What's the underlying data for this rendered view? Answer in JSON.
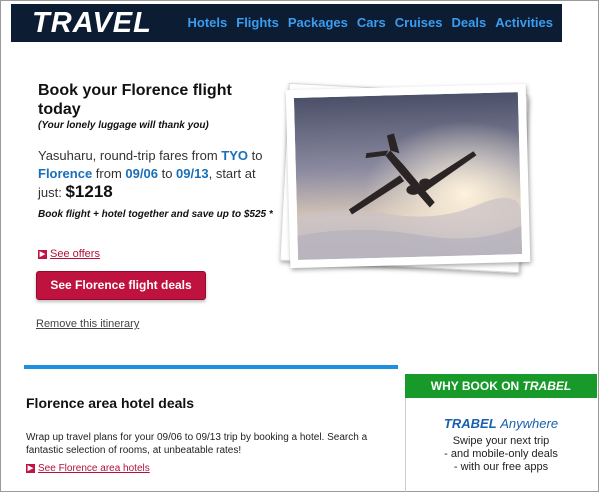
{
  "header": {
    "logo": "TRAVEL",
    "nav": [
      "Hotels",
      "Flights",
      "Packages",
      "Cars",
      "Cruises",
      "Deals",
      "Activities"
    ]
  },
  "hero": {
    "title": "Book your Florence flight today",
    "subtitle": "(Your lonely luggage will thank you)",
    "fares": {
      "prefix": "Yasuharu, round-trip fares from ",
      "origin": "TYO",
      "to1": " to ",
      "destination": "Florence",
      "from_word": " from ",
      "depart": "09/06",
      "to2": " to ",
      "return": "09/13",
      "start_text": ", start at just: ",
      "price": "$1218"
    },
    "bundle": "Book flight + hotel together and save up to $525 *",
    "offers_link": "See offers",
    "cta": "See Florence flight deals",
    "remove_link": "Remove this itinerary"
  },
  "hotels": {
    "title": "Florence area hotel deals",
    "text": "Wrap up travel plans for your 09/06 to 09/13 trip by booking a hotel. Search a fantastic selection of rooms, at unbeatable rates!",
    "link": "See Florence area hotels"
  },
  "why": {
    "bar_prefix": "WHY BOOK ON ",
    "bar_brand": "TRABEL",
    "anywhere_brand": "TRABEL",
    "anywhere_word": "Anywhere",
    "lines": [
      "Swipe your next trip",
      "- and mobile-only deals",
      "- with our free apps"
    ]
  },
  "colors": {
    "header_bg": "#0c1c33",
    "nav_link": "#3a9df0",
    "accent_red": "#c0123f",
    "accent_blue": "#1e90e0",
    "accent_green": "#189a2a"
  },
  "icons": {
    "offers_chevron": "chevron-right-icon",
    "hotels_chevron": "chevron-right-icon"
  }
}
